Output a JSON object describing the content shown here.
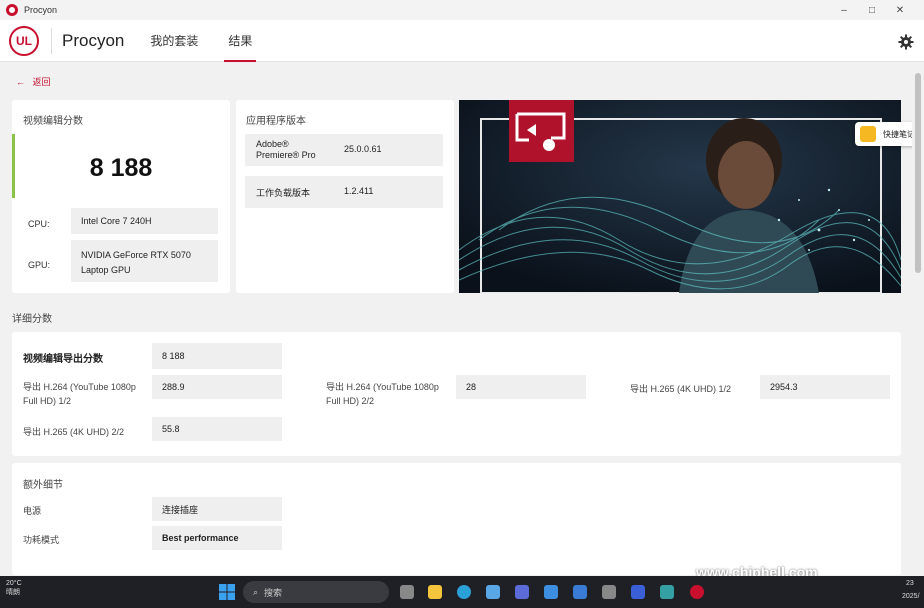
{
  "window": {
    "title": "Procyon",
    "minimize": "–",
    "maximize": "□",
    "close": "✕"
  },
  "header": {
    "brand": "Procyon",
    "logo_text": "UL",
    "tabs": [
      "我的套装",
      "结果"
    ],
    "active_tab_index": 1
  },
  "back_label": "返回",
  "score_card": {
    "title": "视频编辑分数",
    "score": "8 188",
    "cpu_label": "CPU:",
    "cpu_value": "Intel Core 7 240H",
    "gpu_label": "GPU:",
    "gpu_value_line1": "NVIDIA GeForce RTX 5070",
    "gpu_value_line2": "Laptop GPU"
  },
  "app_card": {
    "title": "应用程序版本",
    "rows": [
      {
        "label_line1": "Adobe®",
        "label_line2": "Premiere® Pro",
        "value": "25.0.0.61"
      },
      {
        "label_line1": "工作负载版本",
        "label_line2": "",
        "value": "1.2.411"
      }
    ]
  },
  "quick_note": {
    "label": "快捷笔记"
  },
  "detail_section": {
    "title": "详细分数",
    "main_label": "视频编辑导出分数",
    "main_value": "8 188",
    "items": [
      {
        "line1": "导出 H.264 (YouTube 1080p",
        "line2": "Full HD) 1/2",
        "value": "288.9"
      },
      {
        "line1": "导出 H.264 (YouTube 1080p",
        "line2": "Full HD) 2/2",
        "value": "28"
      },
      {
        "line1": "导出 H.265 (4K UHD) 1/2",
        "line2": "",
        "value": "2954.3"
      },
      {
        "line1": "导出 H.265 (4K UHD) 2/2",
        "line2": "",
        "value": "55.8"
      }
    ]
  },
  "extra_section": {
    "title": "额外细节",
    "rows": [
      {
        "label": "电源",
        "value": "连接插座"
      },
      {
        "label": "功耗模式",
        "value": "Best performance"
      }
    ]
  },
  "taskbar": {
    "temperature": "20°C",
    "weather": "晴朗",
    "search_placeholder": "搜索",
    "watermark": "www.chiphell.com",
    "clock_time": "23",
    "clock_date": "2025/"
  },
  "colors": {
    "accent": "#c8102e",
    "score_bar": "#8bc34a"
  }
}
